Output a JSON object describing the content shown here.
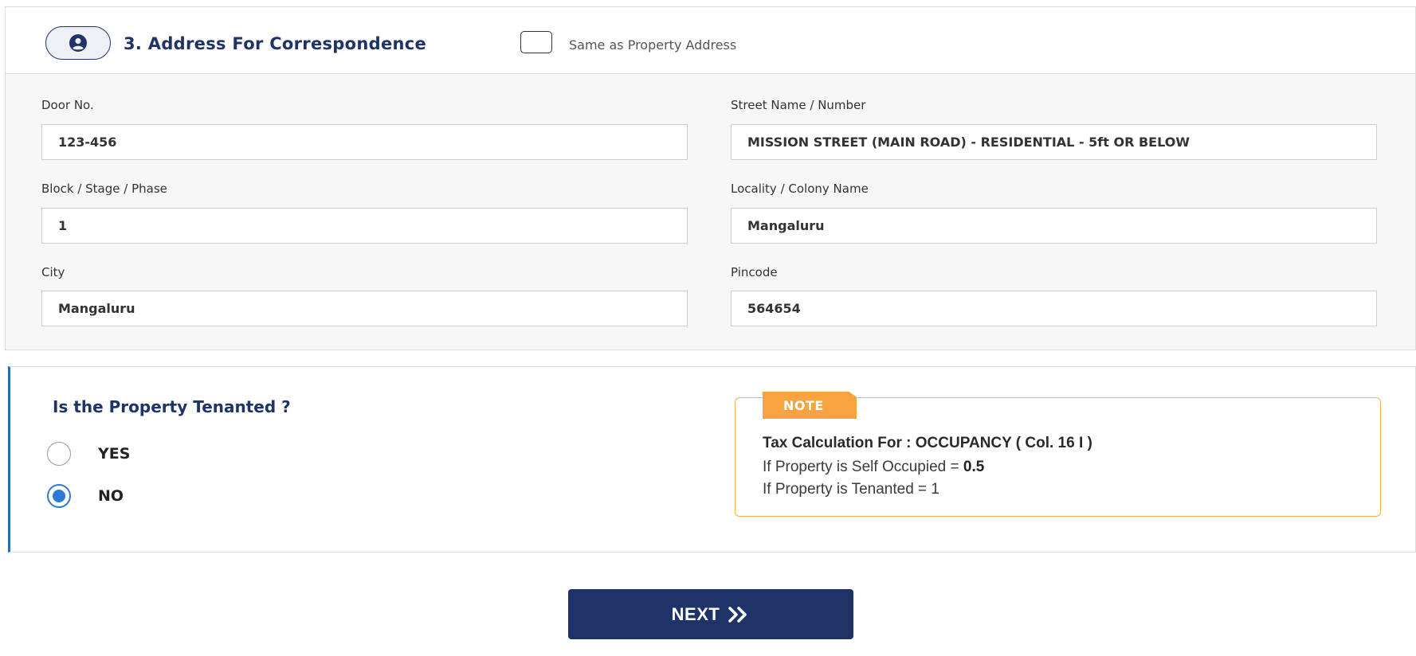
{
  "section": {
    "title": "3. Address For Correspondence",
    "same_as_label": "Same as Property Address",
    "same_as_checked": false
  },
  "fields": {
    "door_no": {
      "label": "Door No.",
      "value": "123-456"
    },
    "street": {
      "label": "Street Name / Number",
      "value": "MISSION STREET (MAIN ROAD) - RESIDENTIAL - 5ft  OR BELOW"
    },
    "block": {
      "label": "Block / Stage / Phase",
      "value": "1"
    },
    "locality": {
      "label": "Locality / Colony Name",
      "value": "Mangaluru"
    },
    "city": {
      "label": "City",
      "value": "Mangaluru"
    },
    "pincode": {
      "label": "Pincode",
      "value": "564654"
    }
  },
  "tenanted": {
    "question": "Is the Property Tenanted ?",
    "options": [
      {
        "label": "YES",
        "checked": false
      },
      {
        "label": "NO",
        "checked": true
      }
    ]
  },
  "note": {
    "tag": "NOTE",
    "line1": "Tax Calculation For : OCCUPANCY ( Col. 16 I )",
    "line2_prefix": "If Property is Self Occupied = ",
    "line2_value": "0.5",
    "line3": "If Property is Tenanted = 1"
  },
  "next_button": {
    "label": "NEXT",
    "icon": "double-chevron-right-icon"
  },
  "colors": {
    "brand_navy": "#1f3368",
    "accent_blue": "#2b7bd6",
    "note_orange": "#f7a440"
  }
}
